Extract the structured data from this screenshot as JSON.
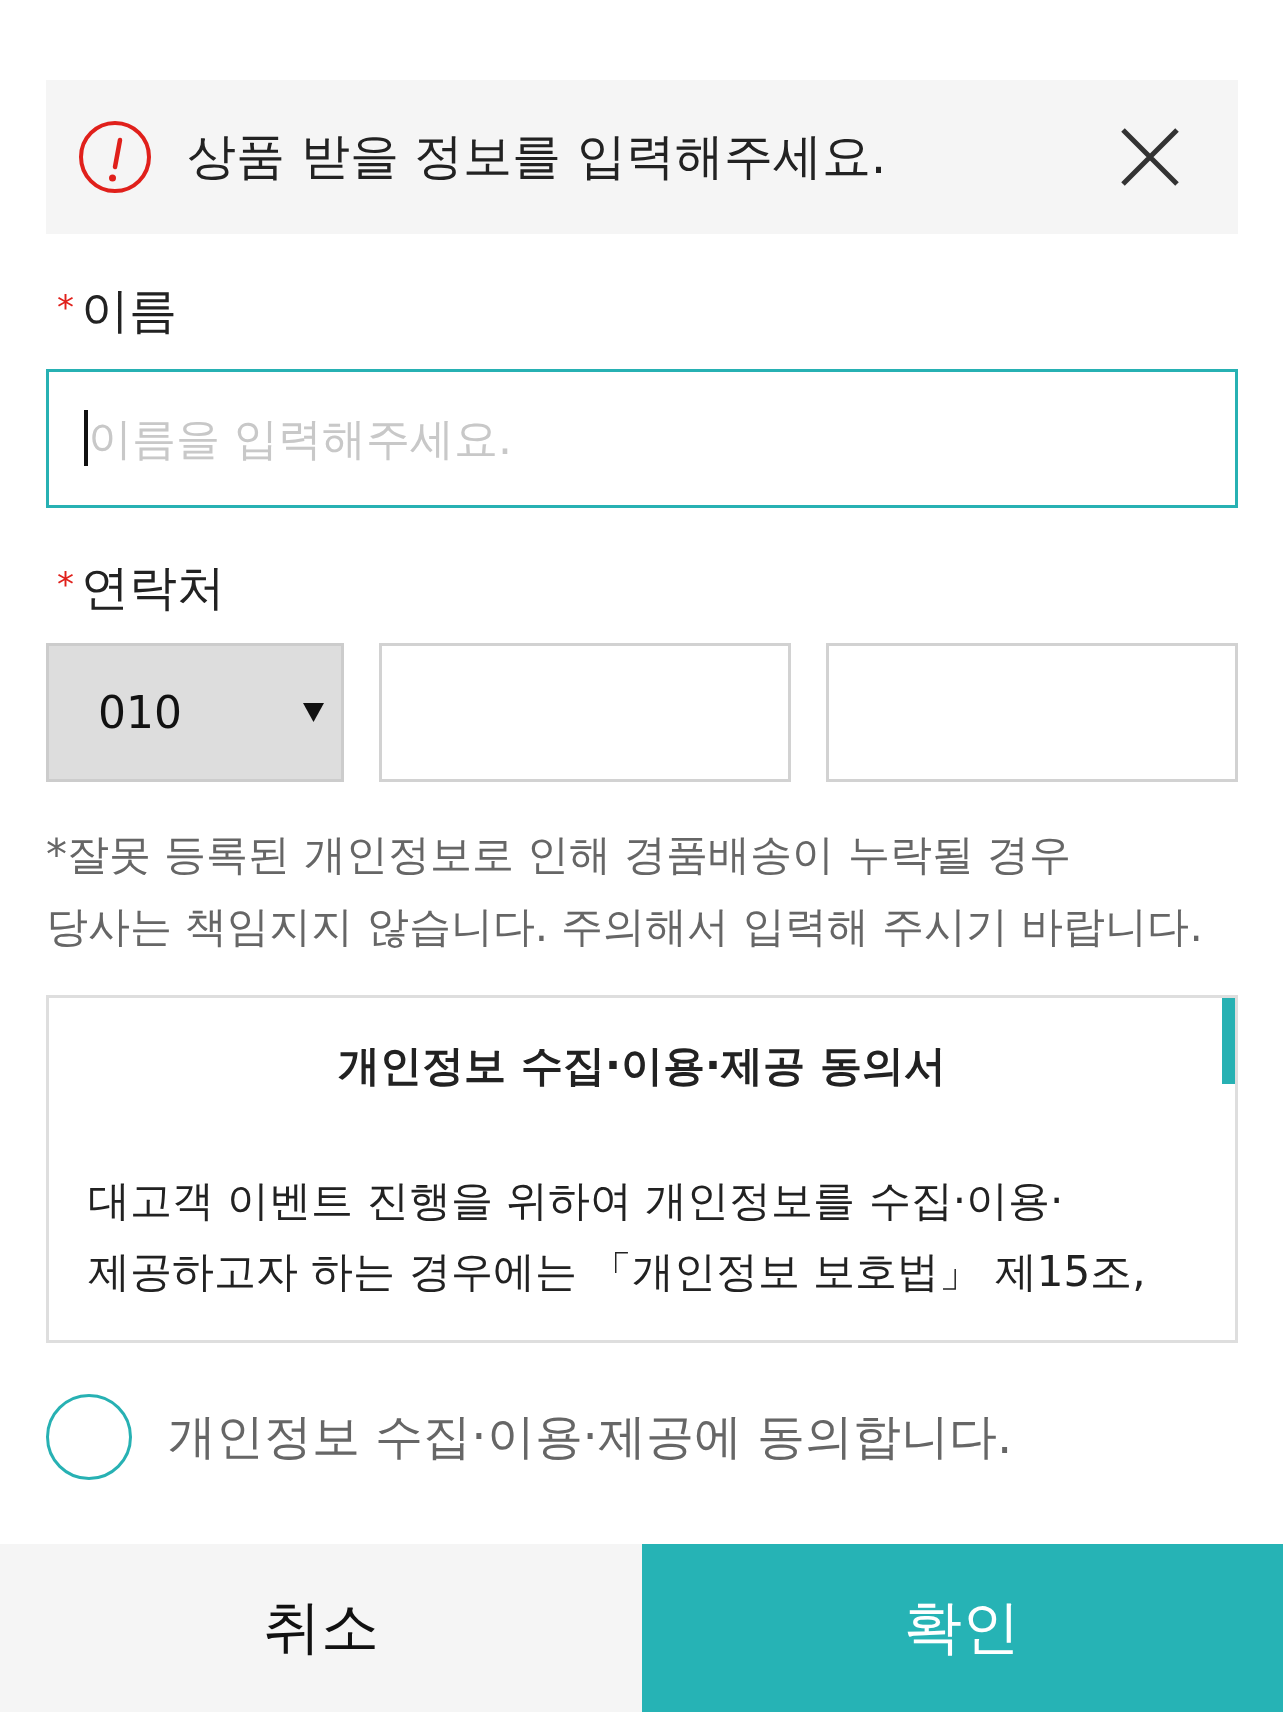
{
  "alert": {
    "message": "상품 받을 정보를 입력해주세요."
  },
  "name": {
    "required_mark": "*",
    "label": "이름",
    "placeholder": "이름을 입력해주세요.",
    "focused": true
  },
  "contact": {
    "required_mark": "*",
    "label": "연락처",
    "prefix": "010"
  },
  "notice": "*잘못 등록된 개인정보로 인해 경품배송이 누락될 경우\n당사는 책임지지 않습니다. 주의해서 입력해 주시기 바랍니다.",
  "consent": {
    "title": "개인정보 수집·이용·제공 동의서",
    "body": "대고객 이벤트 진행을 위하여 개인정보를 수집·이용·\n제공하고자 하는 경우에는 「개인정보 보호법」 제15조,"
  },
  "agreement": {
    "label": "개인정보 수집·이용·제공에 동의합니다.",
    "checked": false
  },
  "buttons": [
    {
      "label": "취소",
      "kind": "cancel"
    },
    {
      "label": "확인",
      "kind": "confirm"
    }
  ]
}
